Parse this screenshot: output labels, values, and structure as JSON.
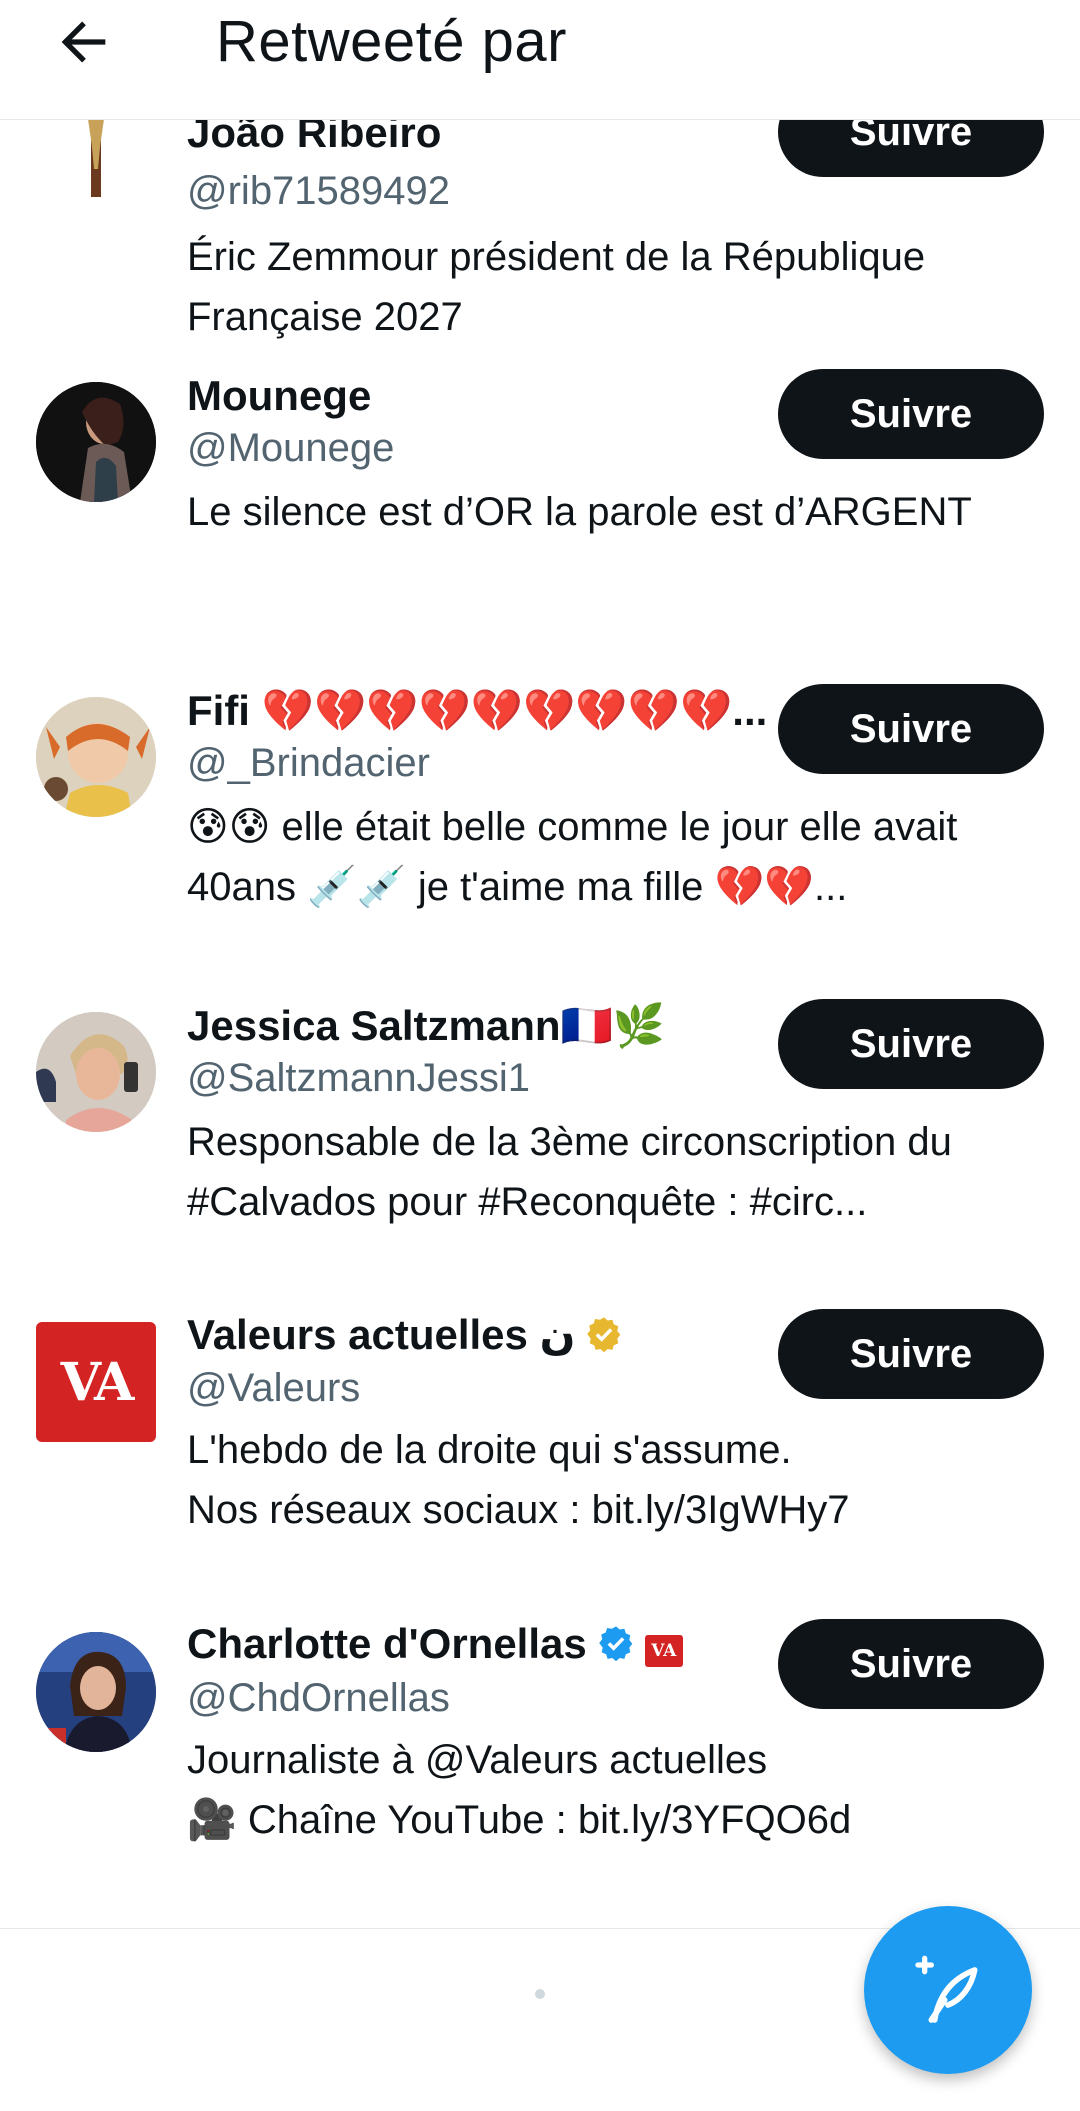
{
  "header": {
    "title": "Retweeté par"
  },
  "follow_label": "Suivre",
  "users": [
    {
      "name": "João Ribeiro",
      "handle": "@rib71589492",
      "bio": "Éric Zemmour président de la République Française 2027"
    },
    {
      "name": "Mounege",
      "handle": "@Mounege",
      "bio": "Le silence est d’OR la parole est d’ARGENT"
    },
    {
      "name": "Fifi 💔💔💔💔💔💔💔💔💔...",
      "handle": "@_Brindacier",
      "bio": "😰😰  elle était belle comme le jour elle avait 40ans 💉💉 je t'aime ma fille 💔💔..."
    },
    {
      "name": "Jessica Saltzmann🇫🇷🌿",
      "handle": "@SaltzmannJessi1",
      "bio": "Responsable de la 3ème circonscription du #Calvados pour #Reconquête : #circ..."
    },
    {
      "name": "Valeurs actuelles ن",
      "handle": "@Valeurs",
      "bio_line1": "L'hebdo de la droite qui s'assume.",
      "bio_line2": "Nos réseaux sociaux : bit.ly/3IgWHy7",
      "avatar_text": "VA"
    },
    {
      "name": "Charlotte d'Ornellas",
      "handle": "@ChdOrnellas",
      "bio_line1": "Journaliste à @Valeurs actuelles",
      "bio_line2": "🎥 Chaîne YouTube : bit.ly/3YFQO6d",
      "badge_text": "VA"
    }
  ],
  "colors": {
    "accent": "#1d9bf0",
    "button_bg": "#0f1419",
    "muted": "#536471",
    "va_red": "#d42323",
    "gold_badge": "#e8b730"
  }
}
